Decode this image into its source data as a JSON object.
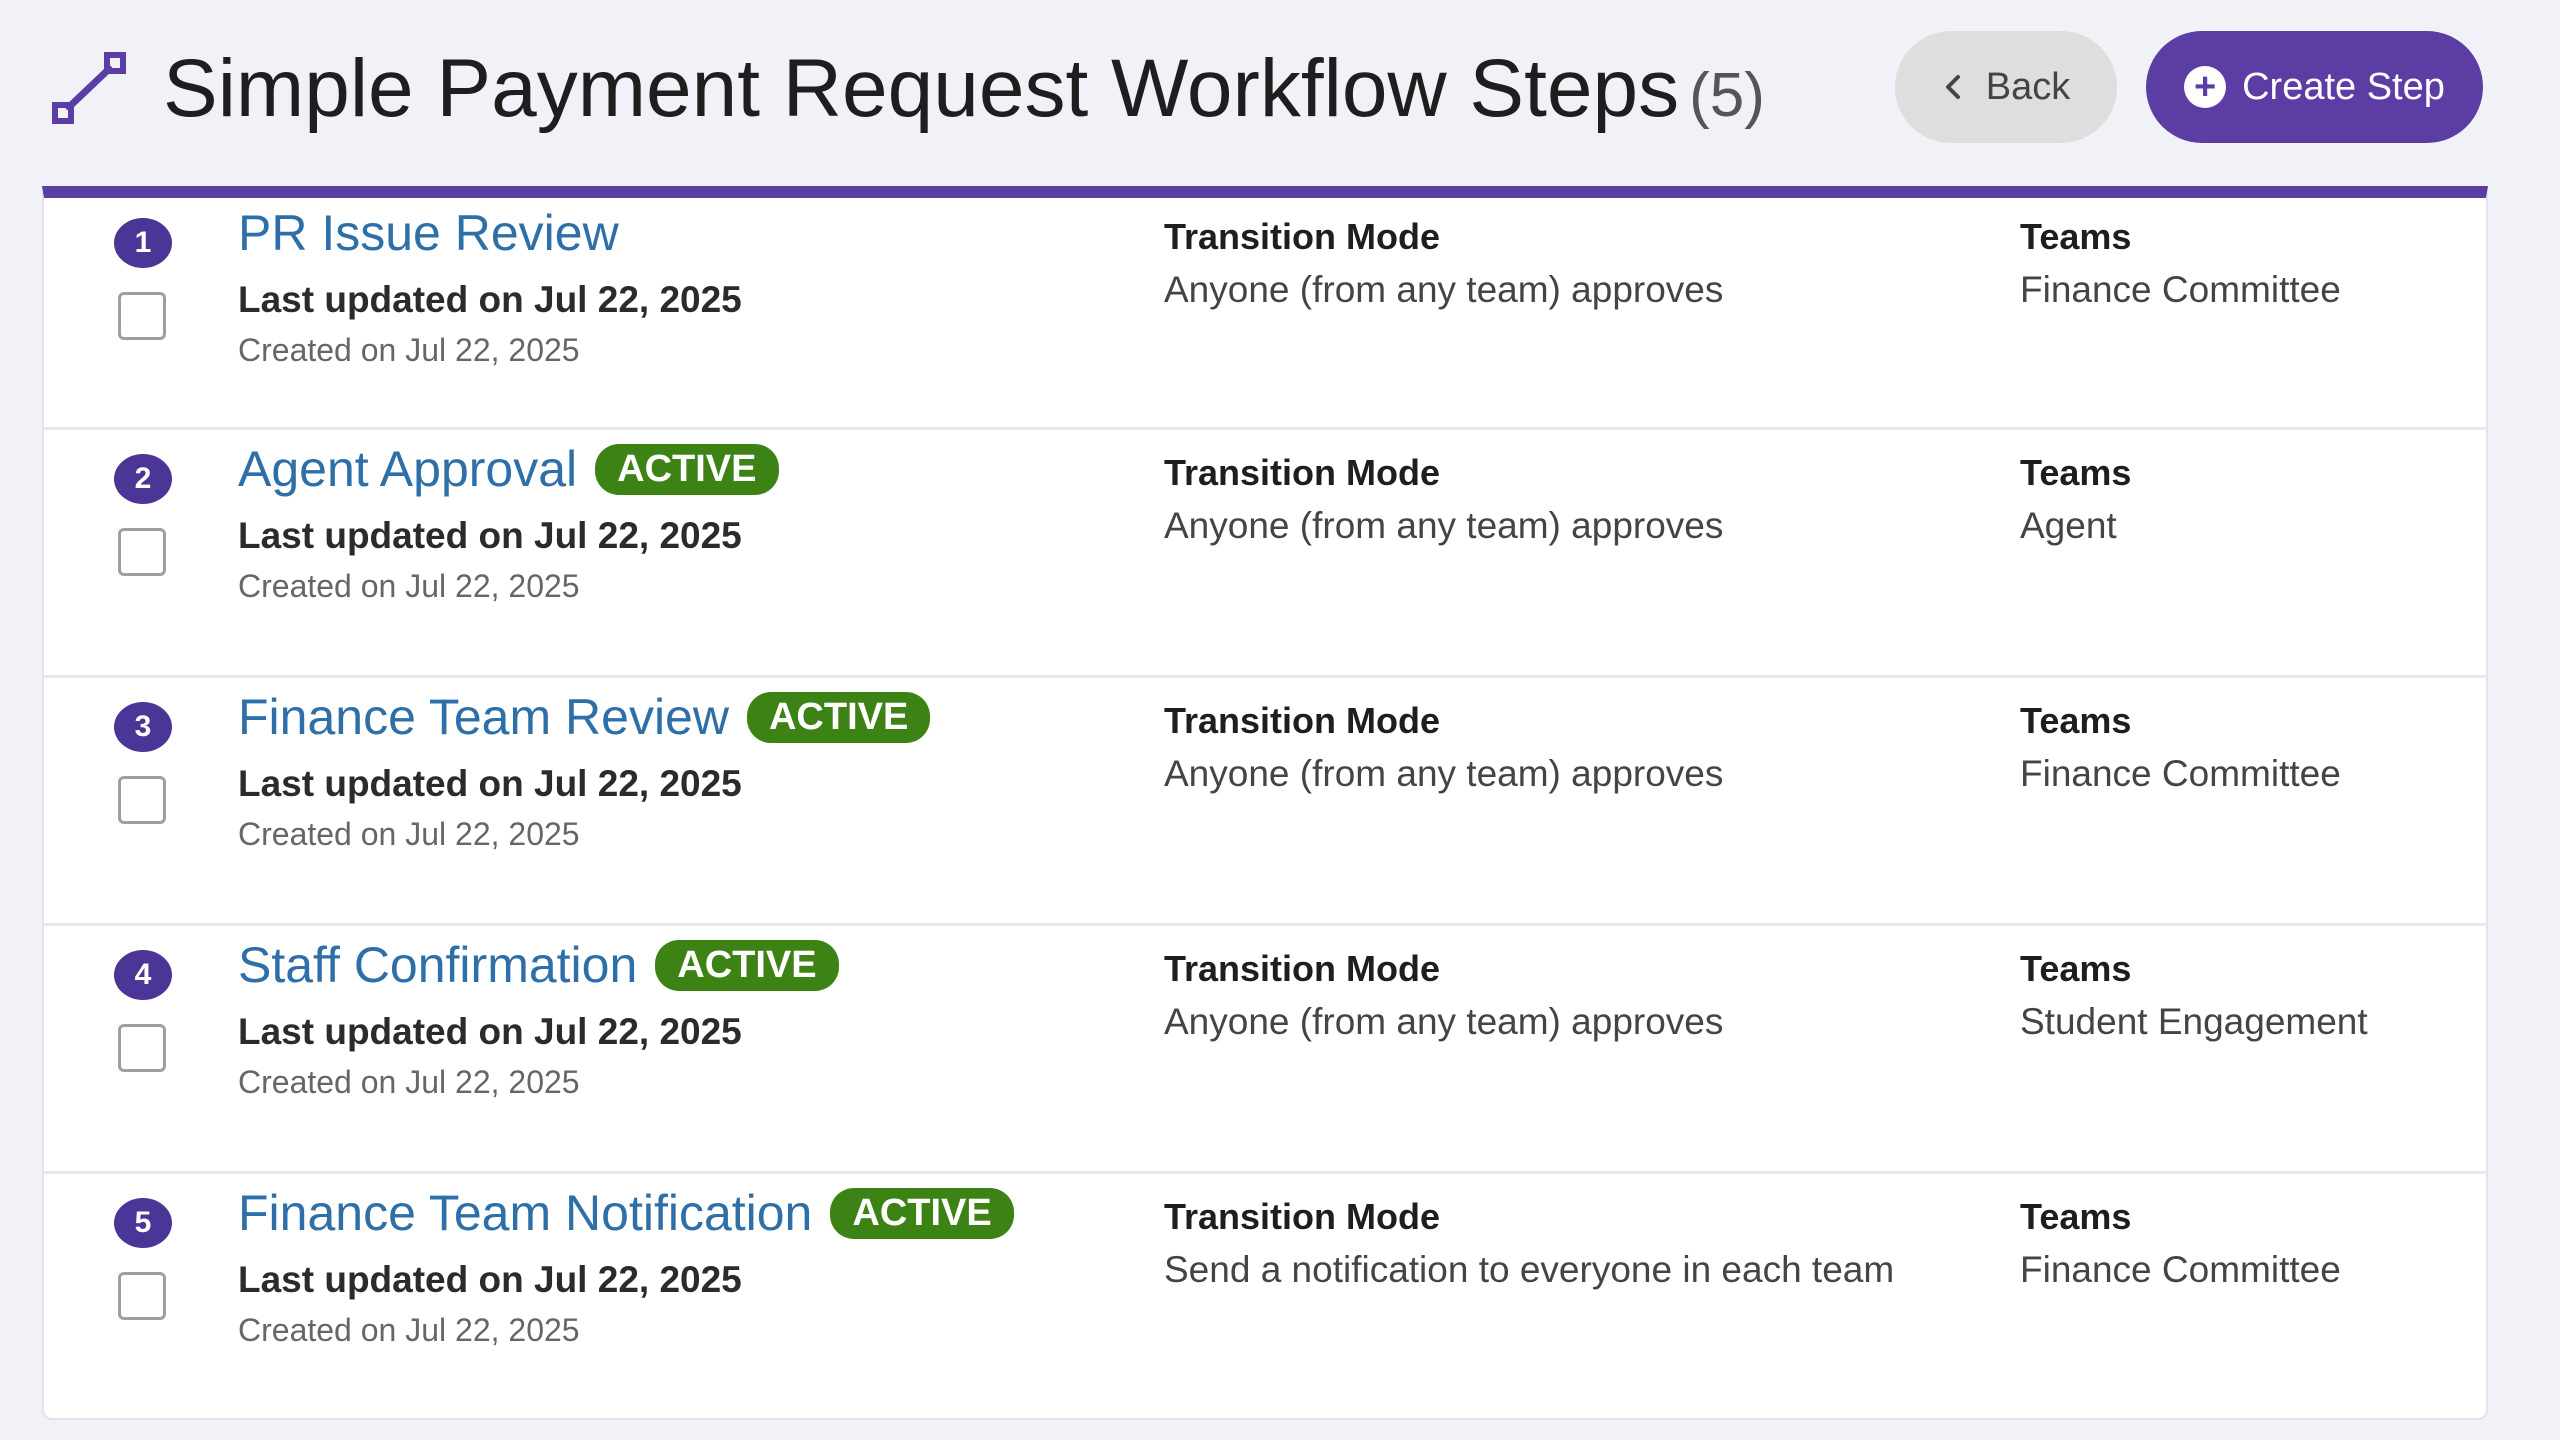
{
  "header": {
    "title": "Simple Payment Request Workflow Steps",
    "count": "(5)",
    "back_label": "Back",
    "create_label": "Create Step",
    "icon": "workflow-connector-icon"
  },
  "colors": {
    "brand": "#5b3da3",
    "badge": "#3d8214",
    "link": "#2f6fa8"
  },
  "columns": {
    "transition_label": "Transition Mode",
    "teams_label": "Teams"
  },
  "steps": [
    {
      "number": "1",
      "name": "PR Issue Review",
      "badge": "",
      "updated": "Last updated on Jul 22, 2025",
      "created": "Created on Jul 22, 2025",
      "transition": "Anyone (from any team) approves",
      "teams": "Finance Committee"
    },
    {
      "number": "2",
      "name": "Agent Approval",
      "badge": "ACTIVE",
      "updated": "Last updated on Jul 22, 2025",
      "created": "Created on Jul 22, 2025",
      "transition": "Anyone (from any team) approves",
      "teams": "Agent"
    },
    {
      "number": "3",
      "name": "Finance Team Review",
      "badge": "ACTIVE",
      "updated": "Last updated on Jul 22, 2025",
      "created": "Created on Jul 22, 2025",
      "transition": "Anyone (from any team) approves",
      "teams": "Finance Committee"
    },
    {
      "number": "4",
      "name": "Staff Confirmation",
      "badge": "ACTIVE",
      "updated": "Last updated on Jul 22, 2025",
      "created": "Created on Jul 22, 2025",
      "transition": "Anyone (from any team) approves",
      "teams": "Student Engagement"
    },
    {
      "number": "5",
      "name": "Finance Team Notification",
      "badge": "ACTIVE",
      "updated": "Last updated on Jul 22, 2025",
      "created": "Created on Jul 22, 2025",
      "transition": "Send a notification to everyone in each team",
      "teams": "Finance Committee"
    }
  ]
}
